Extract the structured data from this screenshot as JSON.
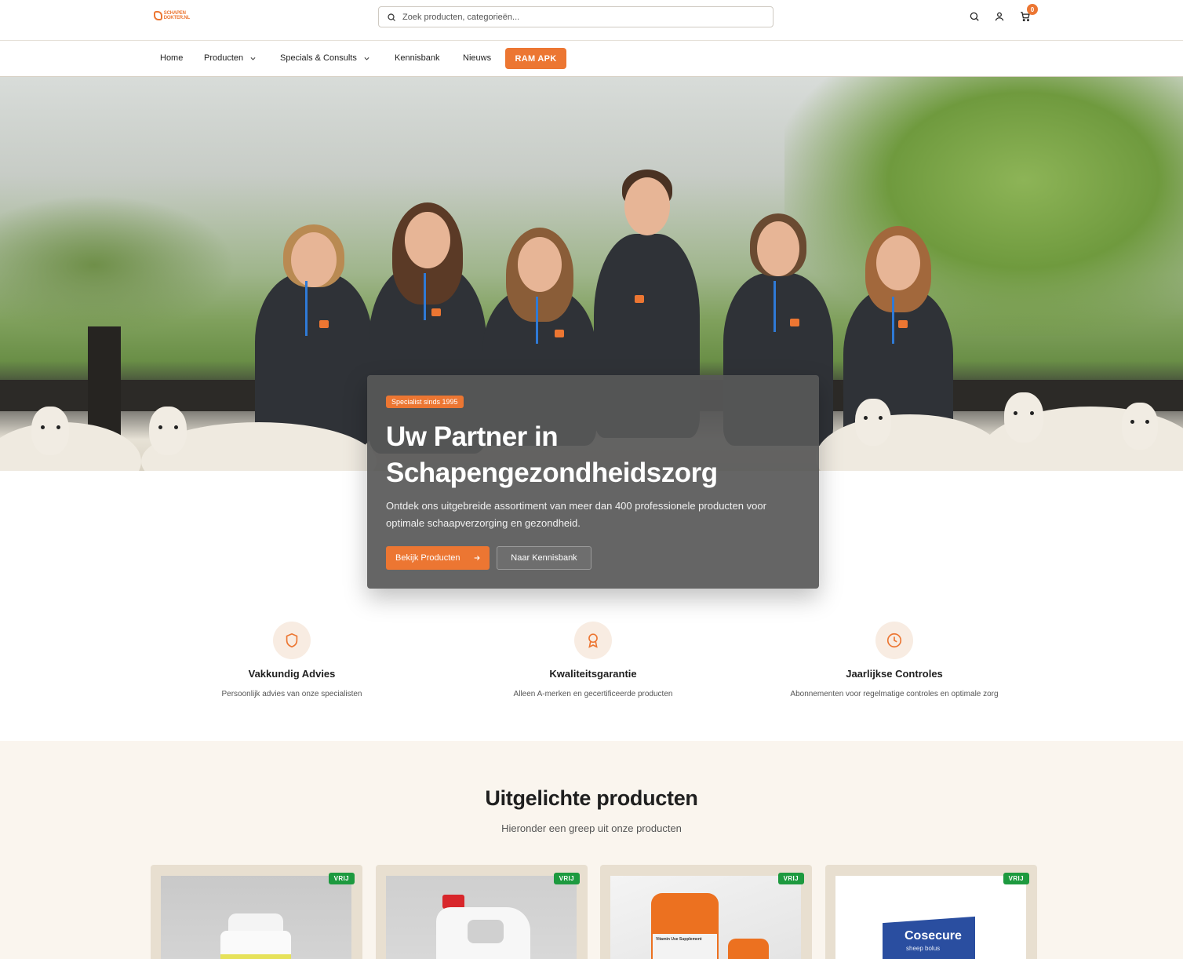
{
  "header": {
    "logo_line1": "SCHAPEN",
    "logo_line2": "DOKTER.NL",
    "search_placeholder": "Zoek producten, categorieën...",
    "cart_count": "0"
  },
  "nav": {
    "items": [
      {
        "label": "Home"
      },
      {
        "label": "Producten"
      },
      {
        "label": "Specials & Consults"
      },
      {
        "label": "Kennisbank"
      },
      {
        "label": "Nieuws"
      }
    ],
    "cta_label": "RAM APK"
  },
  "hero": {
    "badge": "Specialist sinds 1995",
    "title": "Uw Partner in Schapengezondheidszorg",
    "text": "Ontdek ons uitgebreide assortiment van meer dan 400 professionele producten voor optimale schaapverzorging en gezondheid.",
    "primary_button": "Bekijk Producten",
    "secondary_button": "Naar Kennisbank"
  },
  "features": [
    {
      "icon": "shield-icon",
      "title": "Vakkundig Advies",
      "desc": "Persoonlijk advies van onze specialisten"
    },
    {
      "icon": "award-icon",
      "title": "Kwaliteitsgarantie",
      "desc": "Alleen A-merken en gecertificeerde producten"
    },
    {
      "icon": "clock-icon",
      "title": "Jaarlijkse Controles",
      "desc": "Abonnementen voor regelmatige controles en optimale zorg"
    }
  ],
  "products_section": {
    "title": "Uitgelichte producten",
    "subtitle": "Hieronder een greep uit onze producten",
    "cards": [
      {
        "badge": "VRIJ"
      },
      {
        "badge": "VRIJ"
      },
      {
        "badge": "VRIJ",
        "label_text": "Vitamin Use Supplement"
      },
      {
        "badge": "VRIJ",
        "brand": "Cosecure",
        "brand_sub": "sheep bolus"
      }
    ]
  },
  "colors": {
    "accent": "#ec7632",
    "badge_green": "#1d9a3f",
    "section_bg": "#faf5ee"
  }
}
